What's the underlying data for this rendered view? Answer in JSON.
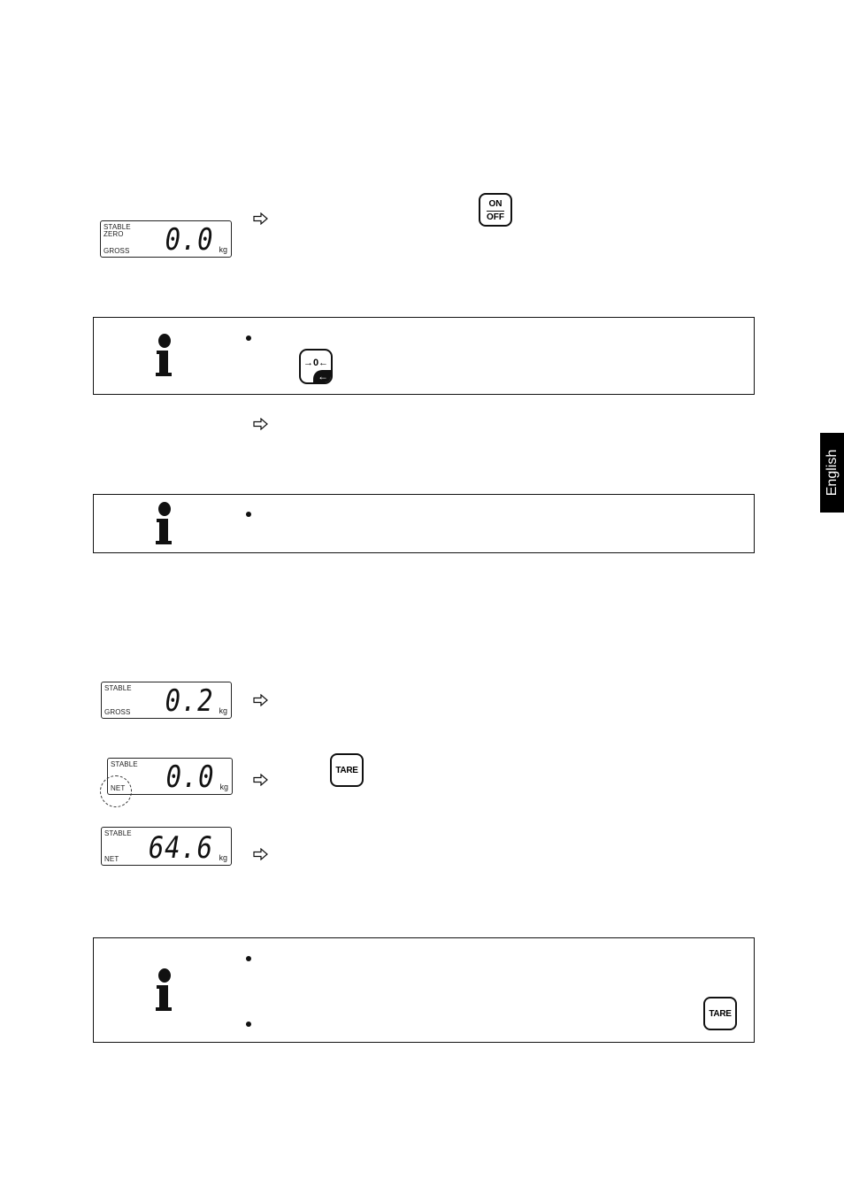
{
  "language_tab": "English",
  "displays": [
    {
      "indicators_top": [
        "STABLE",
        "ZERO"
      ],
      "indicator_bottom": "GROSS",
      "value": "0.0",
      "unit": "kg"
    },
    {
      "indicators_top": [
        "STABLE"
      ],
      "indicator_bottom": "GROSS",
      "value": "0.2",
      "unit": "kg"
    },
    {
      "indicators_top": [
        "STABLE"
      ],
      "indicator_bottom": "NET",
      "value": "0.0",
      "unit": "kg",
      "highlighted": "NET"
    },
    {
      "indicators_top": [
        "STABLE"
      ],
      "indicator_bottom": "NET",
      "value": "64.6",
      "unit": "kg"
    }
  ],
  "keys": {
    "on_off": {
      "top": "ON",
      "bottom": "OFF"
    },
    "zero": {
      "label": "→0←",
      "corner": "←"
    },
    "tare": "TARE",
    "tare_note": "TARE"
  },
  "icons": {
    "arrow": "right-outline-arrow",
    "info": "information-i",
    "bullet": "bullet"
  }
}
